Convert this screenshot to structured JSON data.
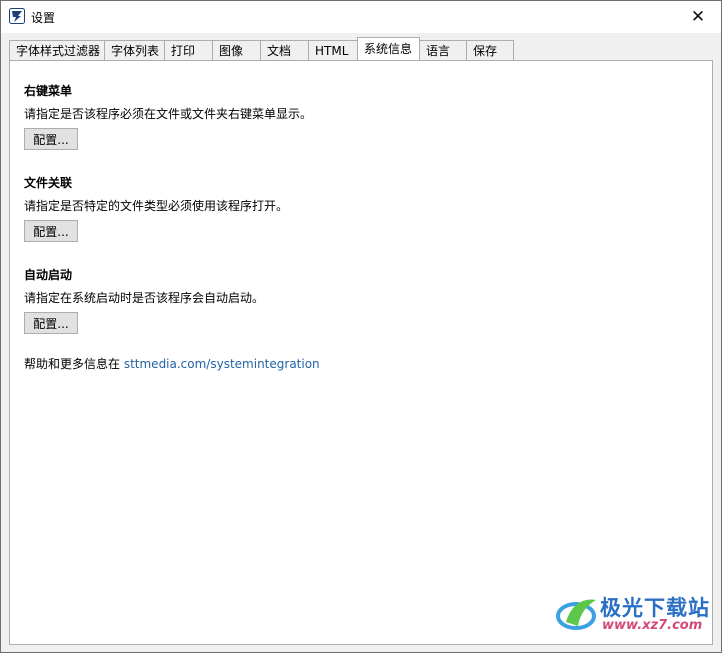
{
  "window": {
    "title": "设置",
    "close_glyph": "✕"
  },
  "tabs": [
    {
      "label": "字体样式过滤器"
    },
    {
      "label": "字体列表"
    },
    {
      "label": "打印"
    },
    {
      "label": "图像"
    },
    {
      "label": "文档"
    },
    {
      "label": "HTML"
    },
    {
      "label": "系统信息",
      "active": true
    },
    {
      "label": "语言"
    },
    {
      "label": "保存"
    }
  ],
  "sections": [
    {
      "title": "右键菜单",
      "description": "请指定是否该程序必须在文件或文件夹右键菜单显示。",
      "button": "配置..."
    },
    {
      "title": "文件关联",
      "description": "请指定是否特定的文件类型必须使用该程序打开。",
      "button": "配置..."
    },
    {
      "title": "自动启动",
      "description": "请指定在系统启动时是否该程序会自动启动。",
      "button": "配置..."
    }
  ],
  "help": {
    "prefix": "帮助和更多信息在 ",
    "link": "sttmedia.com/systemintegration"
  },
  "watermark": {
    "brand": "极光下载站",
    "url": "www.xz7.com"
  },
  "icons": {
    "app": "app-logo-icon",
    "close": "close-icon"
  }
}
